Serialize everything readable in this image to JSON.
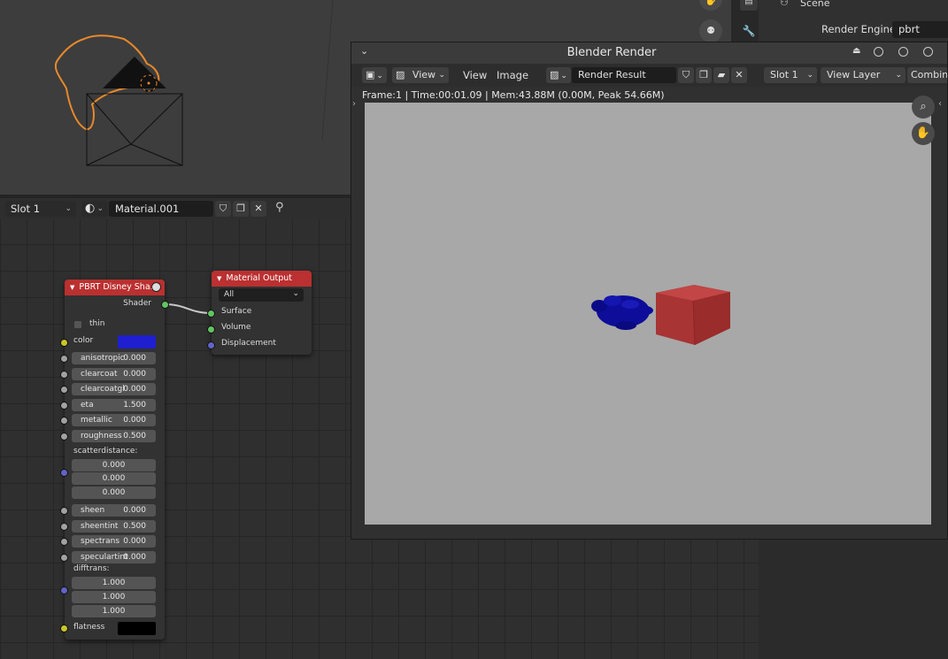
{
  "properties": {
    "scene_label": "Scene",
    "render_engine_label": "Render Engine",
    "render_engine_value": "pbrt"
  },
  "node_editor": {
    "slot": "Slot 1",
    "material_name": "Material.001"
  },
  "disney_node": {
    "title": "PBRT Disney Sha...",
    "output_label": "Shader",
    "thin_label": "thin",
    "color_label": "color",
    "color_value": "#1f1fd0",
    "params": [
      {
        "label": "anisotropic",
        "value": "0.000"
      },
      {
        "label": "clearcoat",
        "value": "0.000"
      },
      {
        "label": "clearcoatgl",
        "value": "0.000"
      },
      {
        "label": "eta",
        "value": "1.500"
      },
      {
        "label": "metallic",
        "value": "0.000"
      },
      {
        "label": "roughness",
        "value": "0.500"
      }
    ],
    "scatter_label": "scatterdistance:",
    "scatter_values": [
      "0.000",
      "0.000",
      "0.000"
    ],
    "params2": [
      {
        "label": "sheen",
        "value": "0.000"
      },
      {
        "label": "sheentint",
        "value": "0.500"
      },
      {
        "label": "spectrans",
        "value": "0.000"
      },
      {
        "label": "speculartint",
        "value": "0.000"
      }
    ],
    "difftrans_label": "difftrans:",
    "difftrans_values": [
      "1.000",
      "1.000",
      "1.000"
    ],
    "flatness_label": "flatness",
    "flatness_color": "#000000"
  },
  "output_node": {
    "title": "Material Output",
    "target": "All",
    "inputs": [
      "Surface",
      "Volume",
      "Displacement"
    ]
  },
  "render_window": {
    "title": "Blender Render",
    "view_label": "View",
    "menu_view": "View",
    "menu_image": "Image",
    "image_name": "Render Result",
    "slot": "Slot 1",
    "view_layer": "View Layer",
    "pass": "Combin",
    "status": "Frame:1 | Time:00:01.09 | Mem:43.88M (0.00M, Peak 54.66M)",
    "background_color": "#a8a8a8",
    "turtle_color": "#0d0d9a",
    "cube_color": "#b33b3b"
  },
  "colors": {
    "node_header": "#bb3030",
    "selection_orange": "#e8892b"
  }
}
